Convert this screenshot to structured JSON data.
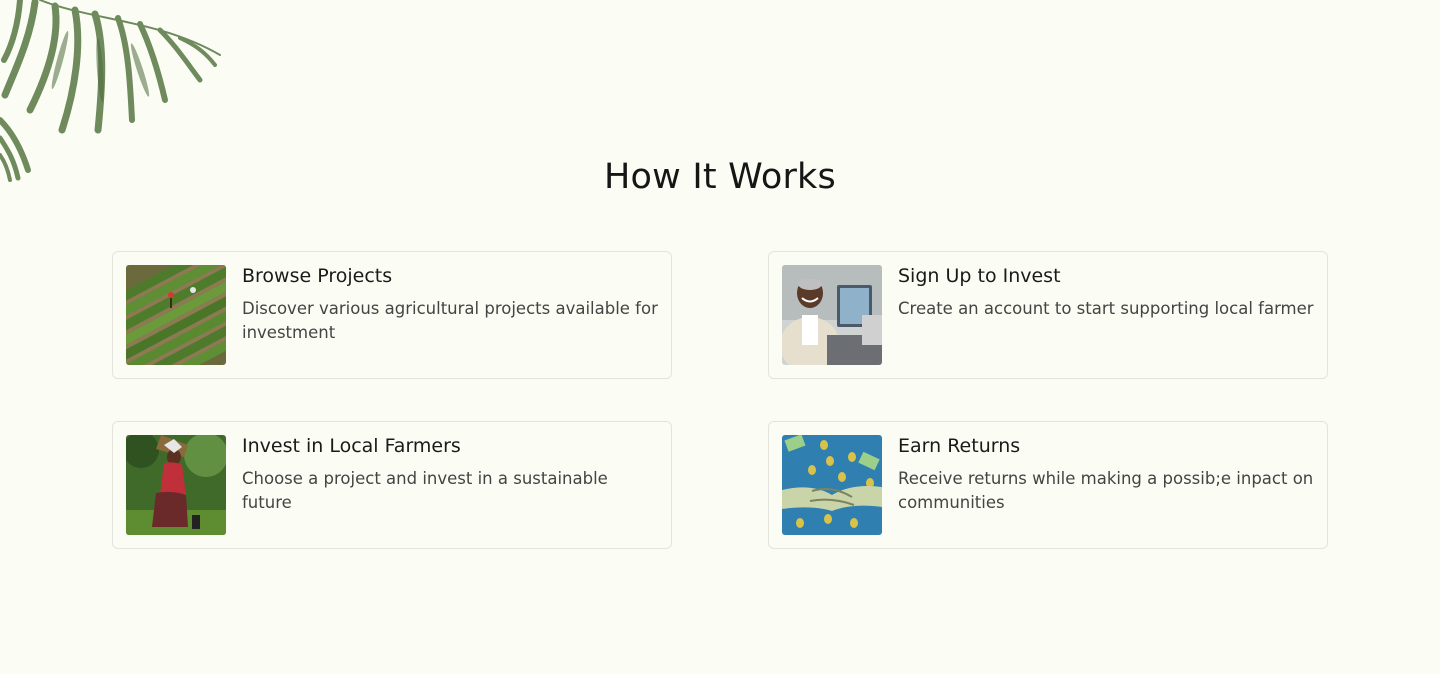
{
  "section": {
    "title": "How It Works"
  },
  "steps": [
    {
      "title": "Browse Projects",
      "description": "Discover various agricultural projects available for investment",
      "image": "farm-field-aerial-photo"
    },
    {
      "title": "Sign Up to Invest",
      "description": "Create an account to start supporting local farmer",
      "image": "man-at-laptop-photo"
    },
    {
      "title": "Invest in Local Farmers",
      "description": "Choose a project and invest in a sustainable future",
      "image": "farmer-carrying-crops-photo"
    },
    {
      "title": "Earn Returns",
      "description": "Receive returns while making a possib;e inpact on communities",
      "image": "handshake-money-illustration"
    }
  ],
  "colors": {
    "background": "#fbfdf4",
    "card_border": "#e3e5dc",
    "title_text": "#161616",
    "body_text": "#444444"
  }
}
